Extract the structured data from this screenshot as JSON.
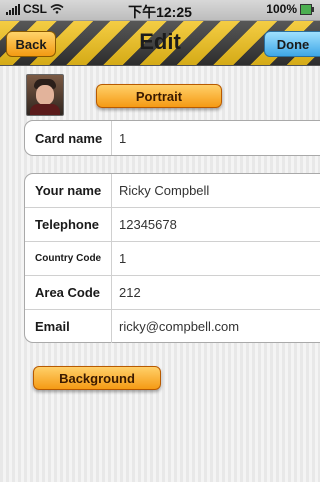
{
  "status_bar": {
    "carrier": "CSL",
    "time": "下午12:25",
    "battery": "100%"
  },
  "nav": {
    "title": "Edit",
    "back_label": "Back",
    "done_label": "Done"
  },
  "portrait": {
    "button_label": "Portrait"
  },
  "card": {
    "label": "Card name",
    "value": "1"
  },
  "fields": [
    {
      "label": "Your name",
      "value": "Ricky Compbell"
    },
    {
      "label": "Telephone",
      "value": "12345678"
    },
    {
      "label": "Country Code",
      "value": "1"
    },
    {
      "label": "Area Code",
      "value": "212"
    },
    {
      "label": "Email",
      "value": "ricky@compbell.com"
    }
  ],
  "background": {
    "button_label": "Background"
  },
  "colors": {
    "nav_stripe_yellow": "#f2c21a",
    "orange_button": "#f59a14",
    "done_button": "#3fa7e6"
  }
}
